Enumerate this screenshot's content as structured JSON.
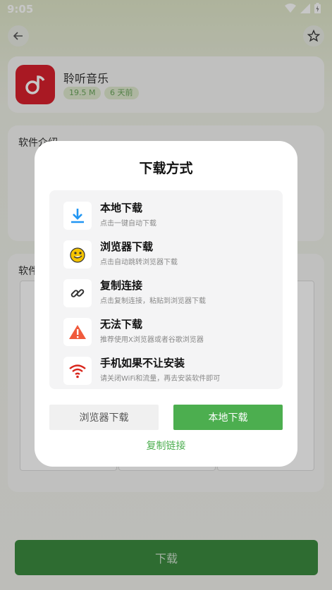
{
  "status_bar": {
    "time": "9:05"
  },
  "app": {
    "name": "聆听音乐",
    "size": "19.5 M",
    "updated": "6 天前"
  },
  "sections": {
    "intro_title": "软件介绍",
    "screenshots_title": "软件截图"
  },
  "bottom": {
    "download_label": "下载"
  },
  "dialog": {
    "title": "下载方式",
    "options": [
      {
        "title": "本地下载",
        "desc": "点击一键自动下载",
        "icon": "download-icon",
        "color": "#2196f3"
      },
      {
        "title": "浏览器下载",
        "desc": "点击自动跳转浏览器下载",
        "icon": "browser-icon",
        "color": "#f5c400"
      },
      {
        "title": "复制连接",
        "desc": "点击复制连接，粘贴到浏览器下载",
        "icon": "link-icon",
        "color": "#333333"
      },
      {
        "title": "无法下载",
        "desc": "推荐使用X浏览器或者谷歌浏览器",
        "icon": "warning-icon",
        "color": "#f05a3c"
      },
      {
        "title": "手机如果不让安装",
        "desc": "请关闭WiFi和流量，再去安装软件即可",
        "icon": "wifi-icon",
        "color": "#d9261c"
      }
    ],
    "browser_button": "浏览器下载",
    "local_button": "本地下载",
    "copy_link": "复制链接"
  }
}
